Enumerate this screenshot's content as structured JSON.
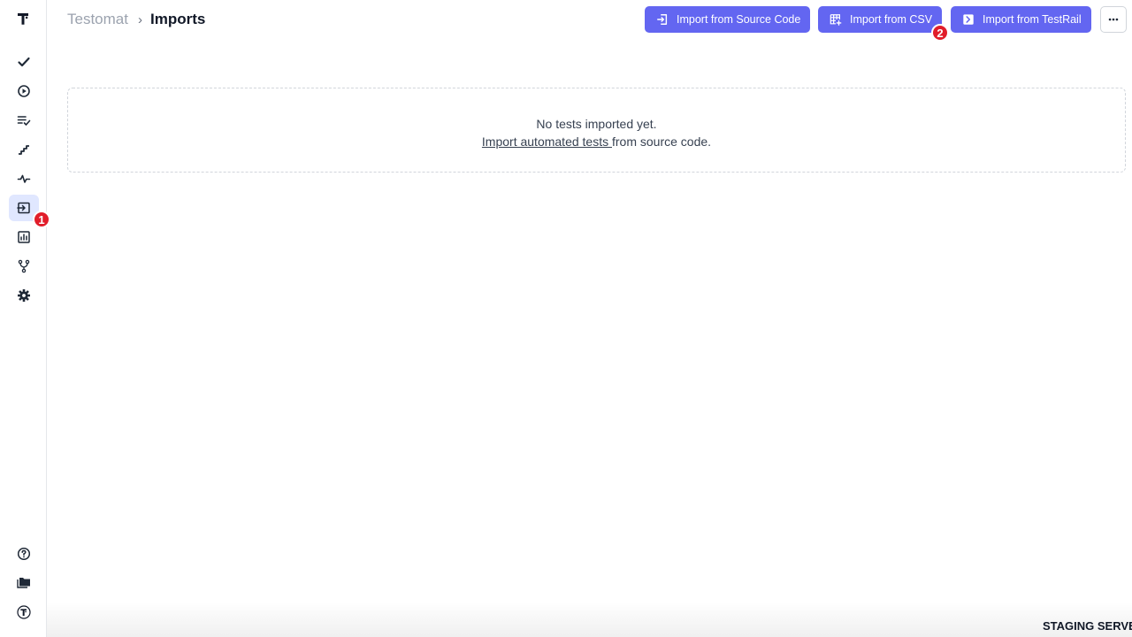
{
  "breadcrumb": {
    "root": "Testomat",
    "separator": "›",
    "current": "Imports"
  },
  "sidebar": {
    "logo_icon": "testomat-logo-icon",
    "items": [
      {
        "name": "tests",
        "icon": "checkmark-icon",
        "active": false
      },
      {
        "name": "runs",
        "icon": "play-circle-icon",
        "active": false
      },
      {
        "name": "plans",
        "icon": "list-check-icon",
        "active": false
      },
      {
        "name": "steps",
        "icon": "stairs-icon",
        "active": false
      },
      {
        "name": "pulse",
        "icon": "pulse-icon",
        "active": false
      },
      {
        "name": "imports",
        "icon": "import-icon",
        "active": true
      },
      {
        "name": "analytics",
        "icon": "bar-chart-icon",
        "active": false
      },
      {
        "name": "branches",
        "icon": "git-branch-icon",
        "active": false
      },
      {
        "name": "settings",
        "icon": "gear-icon",
        "active": false
      }
    ],
    "bottom_items": [
      {
        "name": "help",
        "icon": "question-circle-icon"
      },
      {
        "name": "projects",
        "icon": "folders-icon"
      },
      {
        "name": "account",
        "icon": "testomat-circle-logo-icon"
      }
    ]
  },
  "header": {
    "buttons": [
      {
        "label": "Import from Source Code",
        "icon": "sign-in-icon"
      },
      {
        "label": "Import from CSV",
        "icon": "table-plus-icon"
      },
      {
        "label": "Import from TestRail",
        "icon": "testrail-icon"
      }
    ],
    "more_icon": "ellipsis-icon"
  },
  "empty_state": {
    "line1": "No tests imported yet.",
    "link_text": "Import automated tests ",
    "line2_suffix": "from source code."
  },
  "markers": {
    "one": "1",
    "two": "2"
  },
  "footer": {
    "staging_label": "STAGING SERVE"
  },
  "colors": {
    "accent": "#6366f1",
    "active_nav_bg": "#e0e7ff",
    "marker": "#e11d2a"
  }
}
